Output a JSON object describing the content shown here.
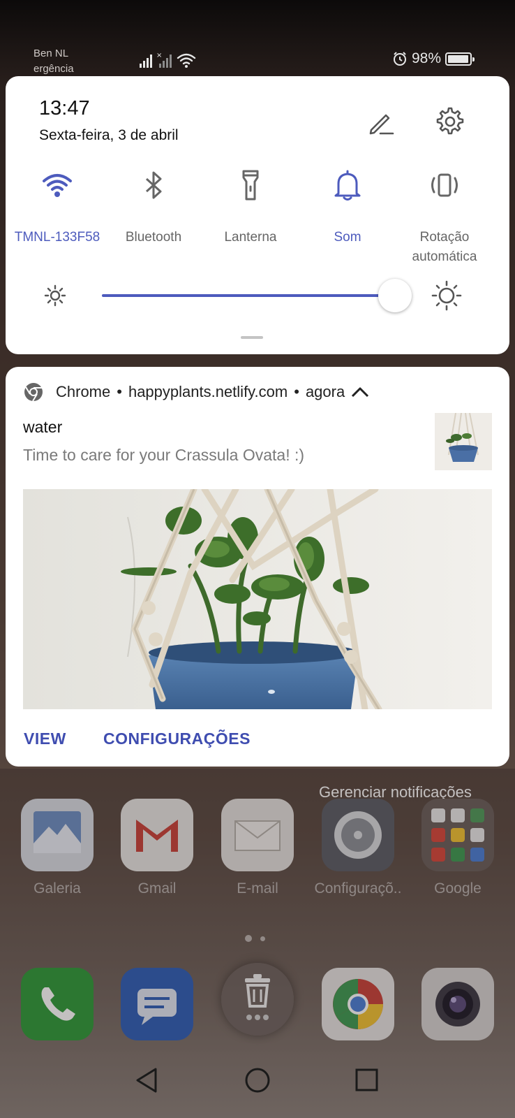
{
  "status_bar": {
    "carrier_line1": "Ben NL",
    "carrier_line2": "ergência",
    "battery_percent": "98%",
    "battery_level": 0.98
  },
  "quick_settings": {
    "time": "13:47",
    "date": "Sexta-feira, 3 de abril",
    "tiles": [
      {
        "label": "TMNL-133F58",
        "icon": "wifi-icon",
        "active": true
      },
      {
        "label": "Bluetooth",
        "icon": "bluetooth-icon",
        "active": false
      },
      {
        "label": "Lanterna",
        "icon": "flashlight-icon",
        "active": false
      },
      {
        "label": "Som",
        "icon": "bell-icon",
        "active": true
      },
      {
        "label": "Rotação automática",
        "icon": "rotation-icon",
        "active": false
      }
    ],
    "brightness_level": 0.92,
    "accent_color": "#4d5bbd"
  },
  "notification": {
    "app": "Chrome",
    "source": "happyplants.netlify.com",
    "time": "agora",
    "title": "water",
    "body": "Time to care for your Crassula Ovata! :)",
    "actions": {
      "view": "VIEW",
      "settings": "CONFIGURAÇÕES"
    },
    "action_color": "#3f4db0"
  },
  "manage_notifications": "Gerenciar notificações",
  "home": {
    "apps_row1": [
      {
        "label": "Galeria",
        "icon": "gallery-icon"
      },
      {
        "label": "Gmail",
        "icon": "gmail-icon"
      },
      {
        "label": "E-mail",
        "icon": "email-icon"
      },
      {
        "label": "Configuraçõ..",
        "icon": "settings-icon"
      },
      {
        "label": "Google",
        "icon": "google-folder-icon"
      }
    ],
    "dock": [
      {
        "name": "Phone",
        "icon": "phone-icon"
      },
      {
        "name": "Messages",
        "icon": "messages-icon"
      },
      {
        "name": "Trash",
        "icon": "trash-icon"
      },
      {
        "name": "Chrome",
        "icon": "chrome-icon"
      },
      {
        "name": "Camera",
        "icon": "camera-icon"
      }
    ]
  },
  "nav": {
    "back": "back-icon",
    "home": "home-icon",
    "recents": "recents-icon"
  }
}
